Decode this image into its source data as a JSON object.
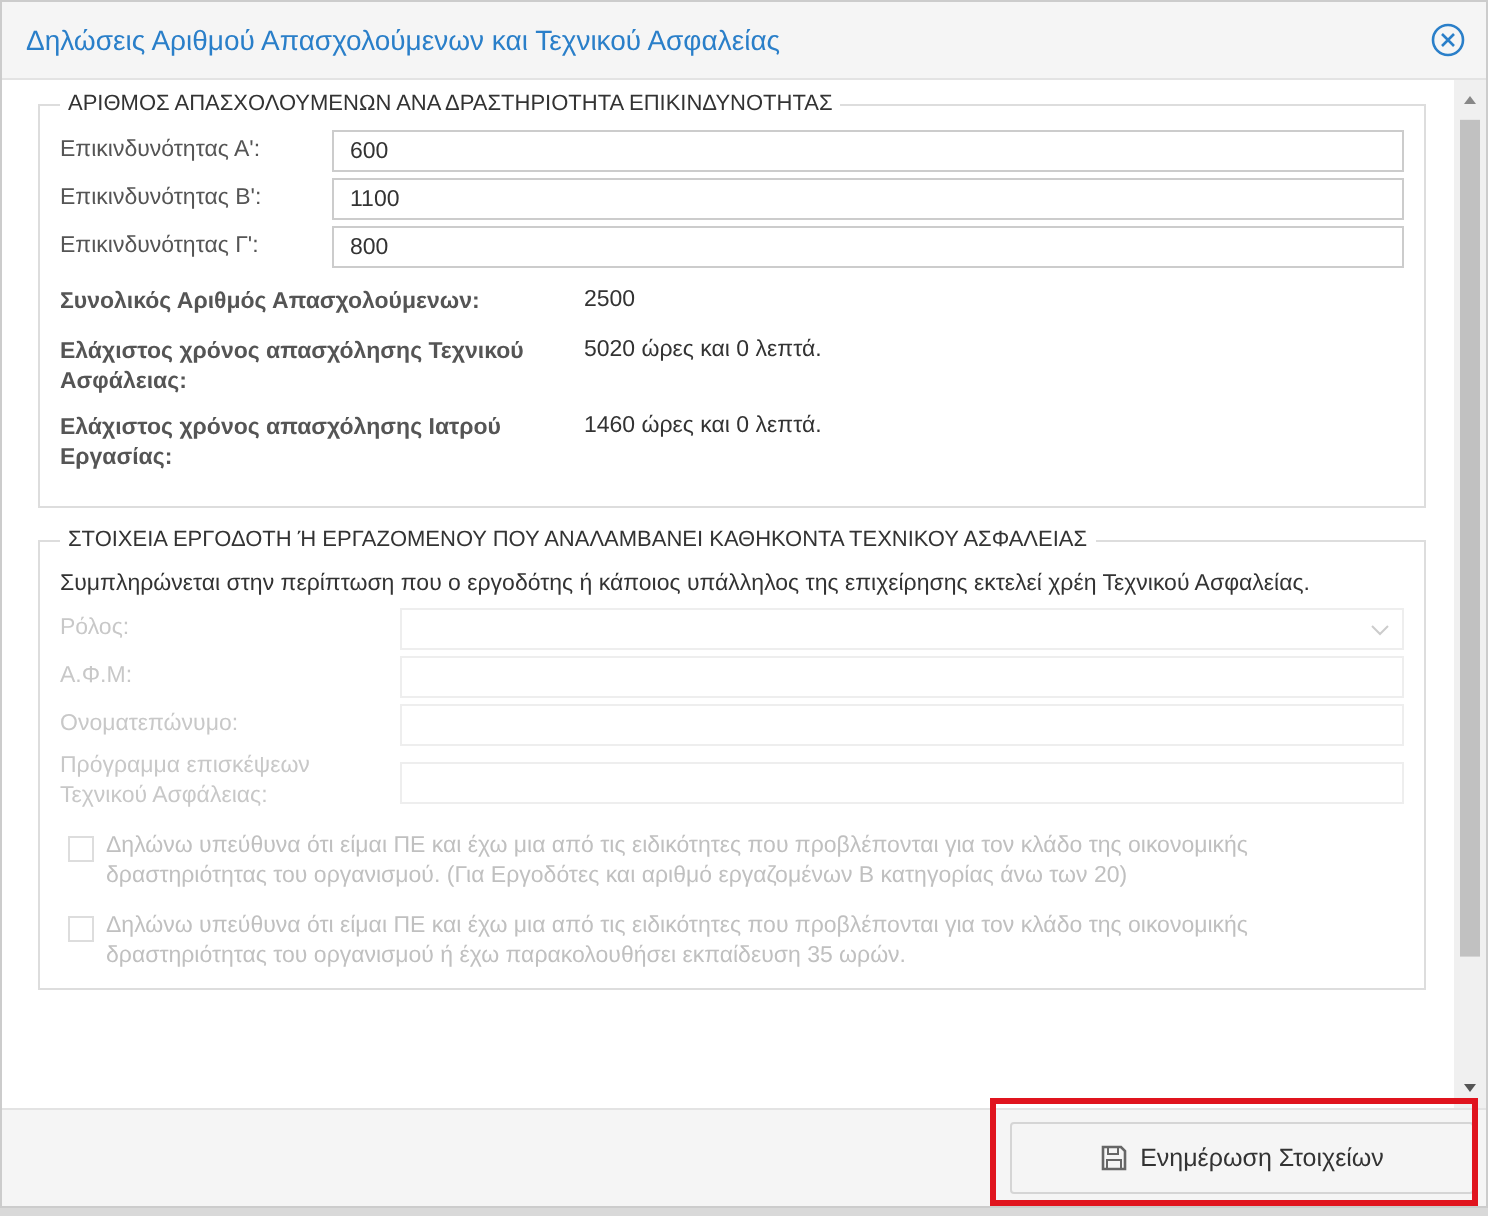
{
  "dialog": {
    "title": "Δηλώσεις Αριθμού Απασχολούμενων και Τεχνικού Ασφαλείας"
  },
  "section_1": {
    "legend": "ΑΡΙΘΜΟΣ ΑΠΑΣΧΟΛΟΥΜΕΝΩΝ ΑΝΑ ΔΡΑΣΤΗΡΙΟΤΗΤΑ ΕΠΙΚΙΝΔΥΝΟΤΗΤΑΣ",
    "fields": [
      {
        "label": "Επικινδυνότητας Α':",
        "value": "600"
      },
      {
        "label": "Επικινδυνότητας Β':",
        "value": "1100"
      },
      {
        "label": "Επικινδυνότητας Γ':",
        "value": "800"
      }
    ],
    "summary": [
      {
        "label": "Συνολικός Αριθμός Απασχολούμενων:",
        "value": "2500"
      },
      {
        "label": "Ελάχιστος χρόνος απασχόλησης Τεχνικού Ασφάλειας:",
        "value": "5020 ώρες και 0 λεπτά."
      },
      {
        "label": "Ελάχιστος χρόνος απασχόλησης Ιατρού Εργασίας:",
        "value": "1460 ώρες και 0 λεπτά."
      }
    ]
  },
  "section_2": {
    "legend": "ΣΤΟΙΧΕΙΑ ΕΡΓΟΔΟΤΗ Ή ΕΡΓΑΖΟΜΕΝΟΥ ΠΟΥ ΑΝΑΛΑΜΒΑΝΕΙ ΚΑΘΗΚΟΝΤΑ ΤΕΧΝΙΚΟΥ ΑΣΦΑΛΕΙΑΣ",
    "note": "Συμπληρώνεται στην περίπτωση που ο εργοδότης ή κάποιος υπάλληλος της επιχείρησης εκτελεί χρέη Τεχνικού Ασφαλείας.",
    "fields": [
      {
        "kind": "select",
        "label": "Ρόλος:",
        "disabled": true
      },
      {
        "kind": "text",
        "label": "Α.Φ.Μ:",
        "disabled": true
      },
      {
        "kind": "text",
        "label": "Ονοματεπώνυμο:",
        "disabled": true
      },
      {
        "kind": "text",
        "label": "Πρόγραμμα επισκέψεων Τεχνικού Ασφάλειας:",
        "disabled": true
      }
    ],
    "checkboxes": [
      {
        "label": "Δηλώνω υπεύθυνα ότι είμαι ΠΕ και έχω μια από τις ειδικότητες που προβλέπονται για τον κλάδο της οικονομικής δραστηριότητας του οργανισμού. (Για Εργοδότες και αριθμό εργαζομένων Β κατηγορίας άνω των 20)",
        "checked": false,
        "disabled": true
      },
      {
        "label": "Δηλώνω υπεύθυνα ότι είμαι ΠΕ και έχω μια από τις ειδικότητες που προβλέπονται για τον κλάδο της οικονομικής δραστηριότητας του οργανισμού ή έχω παρακολουθήσει εκπαίδευση 35 ωρών.",
        "checked": false,
        "disabled": true
      }
    ]
  },
  "footer": {
    "button": {
      "label": "Ενημέρωση Στοιχείων",
      "highlighted": true
    }
  }
}
